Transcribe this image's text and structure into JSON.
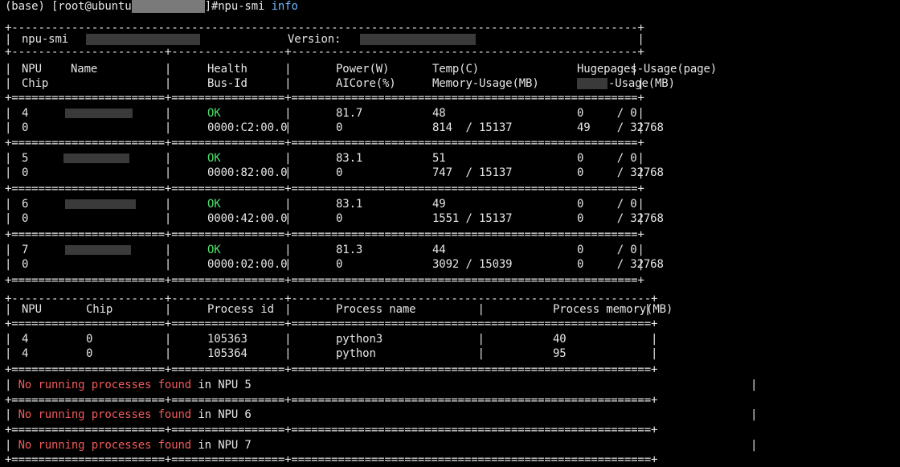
{
  "prompt": {
    "prefix": "(base) [root@ubuntu",
    "suffix": "]#npu-smi ",
    "arg": "info"
  },
  "header": {
    "tool": "npu-smi",
    "version_label": "Version:"
  },
  "columns": {
    "row1": [
      "NPU",
      "Name",
      "Health",
      "Power(W)",
      "Temp(C)",
      "Hugepages-Usage(page)"
    ],
    "row2": [
      "Chip",
      "Bus-Id",
      "AICore(%)",
      "Memory-Usage(MB)",
      "-Usage(MB)"
    ]
  },
  "npus": [
    {
      "npu": "4",
      "chip": "0",
      "health": "OK",
      "bus_id": "0000:C2:00.0",
      "power": "81.7",
      "aicore": "0",
      "temp": "48",
      "memory": "814  / 15137",
      "hugepages": "0     / 0",
      "hbm": "49    / 32768"
    },
    {
      "npu": "5",
      "chip": "0",
      "health": "OK",
      "bus_id": "0000:82:00.0",
      "power": "83.1",
      "aicore": "0",
      "temp": "51",
      "memory": "747  / 15137",
      "hugepages": "0     / 0",
      "hbm": "0     / 32768"
    },
    {
      "npu": "6",
      "chip": "0",
      "health": "OK",
      "bus_id": "0000:42:00.0",
      "power": "83.1",
      "aicore": "0",
      "temp": "49",
      "memory": "1551 / 15137",
      "hugepages": "0     / 0",
      "hbm": "0     / 32768"
    },
    {
      "npu": "7",
      "chip": "0",
      "health": "OK",
      "bus_id": "0000:02:00.0",
      "power": "81.3",
      "aicore": "0",
      "temp": "44",
      "memory": "3092 / 15039",
      "hugepages": "0     / 0",
      "hbm": "0     / 32768"
    }
  ],
  "process_columns": [
    "NPU",
    "Chip",
    "Process id",
    "Process name",
    "Process memory(MB)"
  ],
  "processes": [
    {
      "npu": "4",
      "chip": "0",
      "pid": "105363",
      "name": "python3",
      "memory": "40"
    },
    {
      "npu": "4",
      "chip": "0",
      "pid": "105364",
      "name": "python",
      "memory": "95"
    }
  ],
  "no_process": [
    {
      "warn": "No running processes found",
      "suffix": " in NPU 5"
    },
    {
      "warn": "No running processes found",
      "suffix": " in NPU 6"
    },
    {
      "warn": "No running processes found",
      "suffix": " in NPU 7"
    }
  ],
  "colors": {
    "ok": "#4ee06a",
    "warn": "#f05a5a",
    "command": "#6fb8ff",
    "background": "#000000",
    "foreground": "#e6e6e6"
  }
}
